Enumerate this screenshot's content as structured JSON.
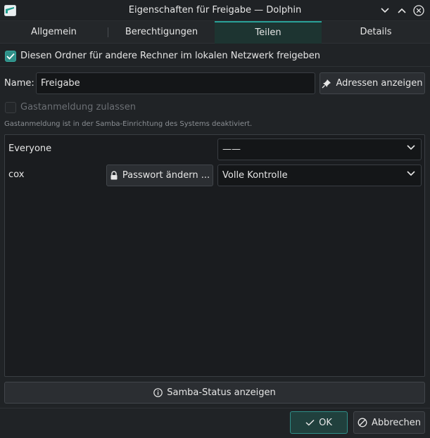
{
  "window": {
    "title": "Eigenschaften für Freigabe — Dolphin"
  },
  "tabs": [
    {
      "label": "Allgemein"
    },
    {
      "label": "Berechtigungen"
    },
    {
      "label": "Teilen"
    },
    {
      "label": "Details"
    }
  ],
  "active_tab": "Teilen",
  "share": {
    "share_checkbox_label": "Diesen Ordner für andere Rechner im lokalen Netzwerk freigeben",
    "share_checked": true,
    "name_label": "Name:",
    "name_value": "Freigabe",
    "show_addresses_label": "Adressen anzeigen",
    "guest_checkbox_label": "Gastanmeldung zulassen",
    "guest_checked": false,
    "guest_note": "Gastanmeldung ist in der Samba-Einrichtung des Systems deaktiviert."
  },
  "users": [
    {
      "name": "Everyone",
      "permission": "——",
      "has_password_button": false
    },
    {
      "name": "cox",
      "permission": "Volle Kontrolle",
      "has_password_button": true,
      "password_button_label": "Passwort ändern ..."
    }
  ],
  "samba_status_label": "Samba-Status anzeigen",
  "footer": {
    "ok_label": "OK",
    "cancel_label": "Abbrechen"
  },
  "colors": {
    "background": "#202326",
    "accent": "#2aa198",
    "input_bg": "#141618"
  }
}
